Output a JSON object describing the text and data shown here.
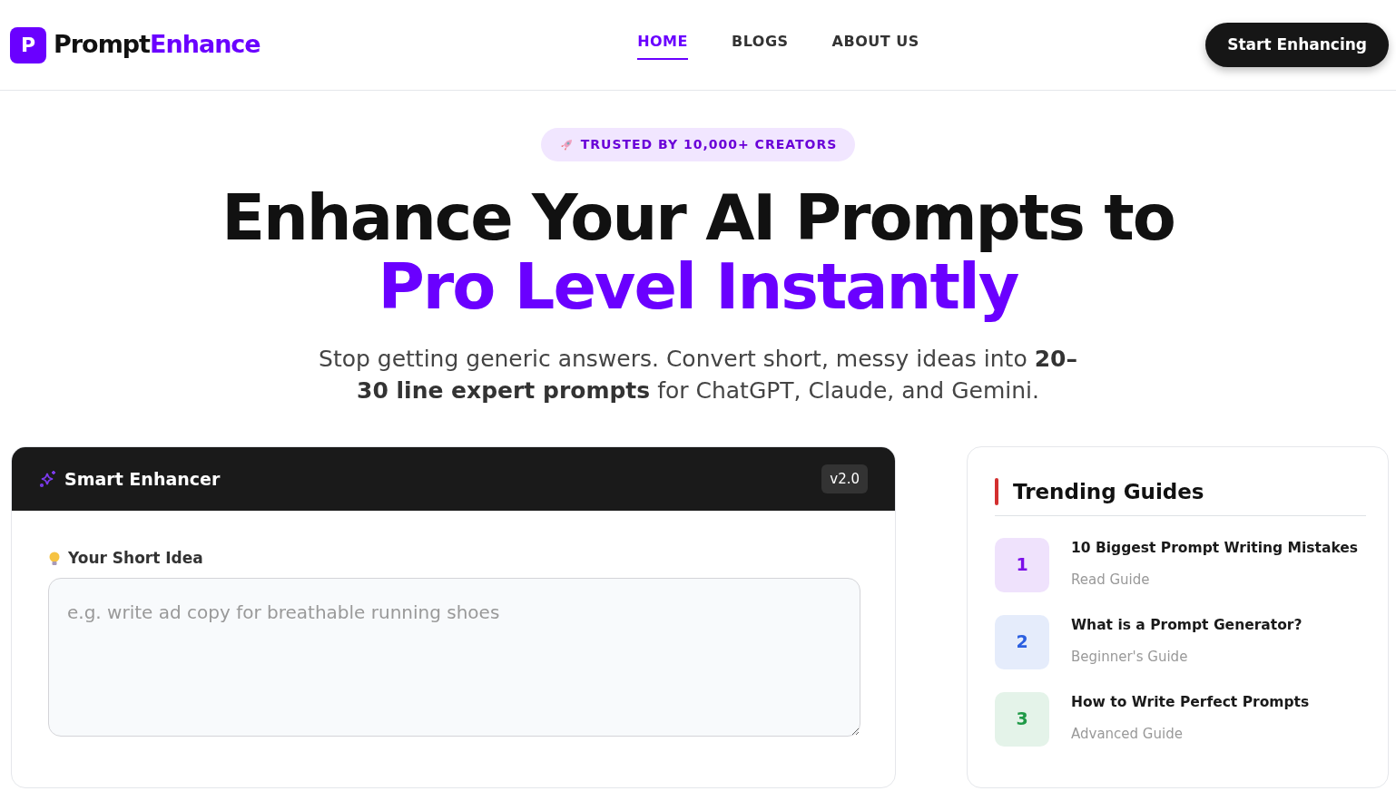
{
  "brand": {
    "logo_letter": "P",
    "name_part1": "Prompt",
    "name_part2": "Enhance"
  },
  "nav": [
    {
      "label": "HOME",
      "selected": true
    },
    {
      "label": "BLOGS",
      "selected": false
    },
    {
      "label": "ABOUT US",
      "selected": false
    }
  ],
  "cta_button": "Start Enhancing",
  "hero": {
    "badge": "TRUSTED BY 10,000+ CREATORS",
    "title_line1": "Enhance Your AI Prompts to",
    "title_line2": "Pro Level Instantly",
    "subtitle": "Stop getting generic answers. Convert short, messy ideas into **20–30 line expert prompts** for ChatGPT, Claude, and Gemini."
  },
  "enhancer": {
    "title": "Smart Enhancer",
    "version": "v2.0",
    "field_label": "Your Short Idea",
    "placeholder": "e.g. write ad copy for breathable running shoes"
  },
  "trending": {
    "title": "Trending Guides",
    "items": [
      {
        "number": "1",
        "title": "10 Biggest Prompt Writing Mistakes",
        "subtitle": "Read Guide",
        "color": "#7c0fe8"
      },
      {
        "number": "2",
        "title": "What is a Prompt Generator?",
        "subtitle": "Beginner's Guide",
        "color": "#2b5fe0"
      },
      {
        "number": "3",
        "title": "How to Write Perfect Prompts",
        "subtitle": "Advanced Guide",
        "color": "#1f9a47"
      }
    ]
  }
}
